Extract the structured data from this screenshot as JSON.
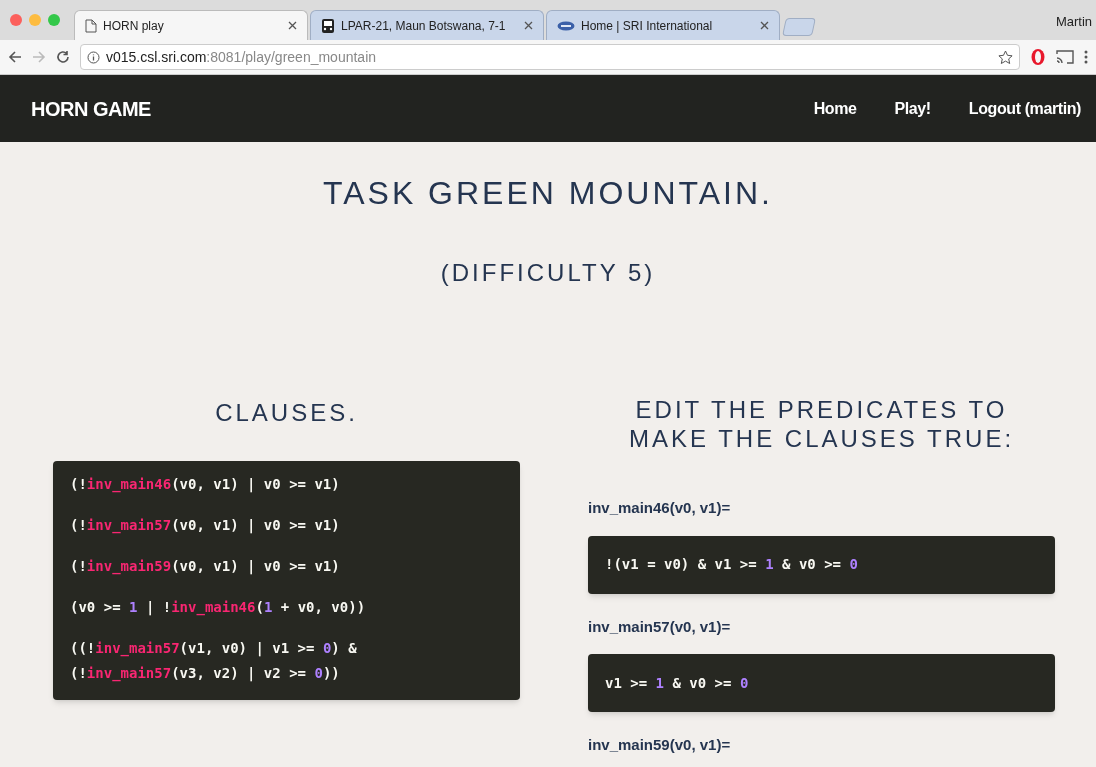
{
  "browser": {
    "tabs": [
      {
        "title": "HORN play",
        "selected": true
      },
      {
        "title": "LPAR-21, Maun Botswana, 7-1",
        "selected": false
      },
      {
        "title": "Home | SRI International",
        "selected": false
      }
    ],
    "profile": "Martin",
    "url_host": "v015.csl.sri.com",
    "url_path": ":8081/play/green_mountain"
  },
  "navbar": {
    "brand": "HORN GAME",
    "links": [
      "Home",
      "Play!",
      "Logout (martin)"
    ]
  },
  "title": "TASK GREEN MOUNTAIN.",
  "difficulty": "(DIFFICULTY 5)",
  "clauses": {
    "heading": "CLAUSES.",
    "items": [
      {
        "lines": [
          [
            {
              "t": "(!",
              "kind": "plain"
            },
            {
              "t": "inv_main46",
              "kind": "pred"
            },
            {
              "t": "(v0, v1) | v0 >= v1)",
              "kind": "plain"
            }
          ]
        ]
      },
      {
        "lines": [
          [
            {
              "t": "(!",
              "kind": "plain"
            },
            {
              "t": "inv_main57",
              "kind": "pred"
            },
            {
              "t": "(v0, v1) | v0 >= v1)",
              "kind": "plain"
            }
          ]
        ]
      },
      {
        "lines": [
          [
            {
              "t": "(!",
              "kind": "plain"
            },
            {
              "t": "inv_main59",
              "kind": "pred"
            },
            {
              "t": "(v0, v1) | v0 >= v1)",
              "kind": "plain"
            }
          ]
        ]
      },
      {
        "lines": [
          [
            {
              "t": "(v0 >= ",
              "kind": "plain"
            },
            {
              "t": "1",
              "kind": "num"
            },
            {
              "t": " | !",
              "kind": "plain"
            },
            {
              "t": "inv_main46",
              "kind": "pred"
            },
            {
              "t": "(",
              "kind": "plain"
            },
            {
              "t": "1",
              "kind": "num"
            },
            {
              "t": " + v0, v0))",
              "kind": "plain"
            }
          ]
        ]
      },
      {
        "lines": [
          [
            {
              "t": "((!",
              "kind": "plain"
            },
            {
              "t": "inv_main57",
              "kind": "pred"
            },
            {
              "t": "(v1, v0) | v1 >= ",
              "kind": "plain"
            },
            {
              "t": "0",
              "kind": "num"
            },
            {
              "t": ") &",
              "kind": "plain"
            }
          ],
          [
            {
              "t": "(!",
              "kind": "plain"
            },
            {
              "t": "inv_main57",
              "kind": "pred"
            },
            {
              "t": "(v3, v2) | v2 >= ",
              "kind": "plain"
            },
            {
              "t": "0",
              "kind": "num"
            },
            {
              "t": "))",
              "kind": "plain"
            }
          ]
        ]
      }
    ]
  },
  "predicates": {
    "heading": "EDIT THE PREDICATES TO MAKE THE CLAUSES TRUE:",
    "items": [
      {
        "label": "inv_main46(v0, v1)=",
        "code": [
          {
            "t": "!(v1 = v0) & v1 >= ",
            "kind": "plain"
          },
          {
            "t": "1",
            "kind": "num"
          },
          {
            "t": " & v0 >= ",
            "kind": "plain"
          },
          {
            "t": "0",
            "kind": "num"
          }
        ]
      },
      {
        "label": "inv_main57(v0, v1)=",
        "code": [
          {
            "t": "v1 >= ",
            "kind": "plain"
          },
          {
            "t": "1",
            "kind": "num"
          },
          {
            "t": " & v0 >= ",
            "kind": "plain"
          },
          {
            "t": "0",
            "kind": "num"
          }
        ]
      },
      {
        "label": "inv_main59(v0, v1)="
      }
    ]
  }
}
